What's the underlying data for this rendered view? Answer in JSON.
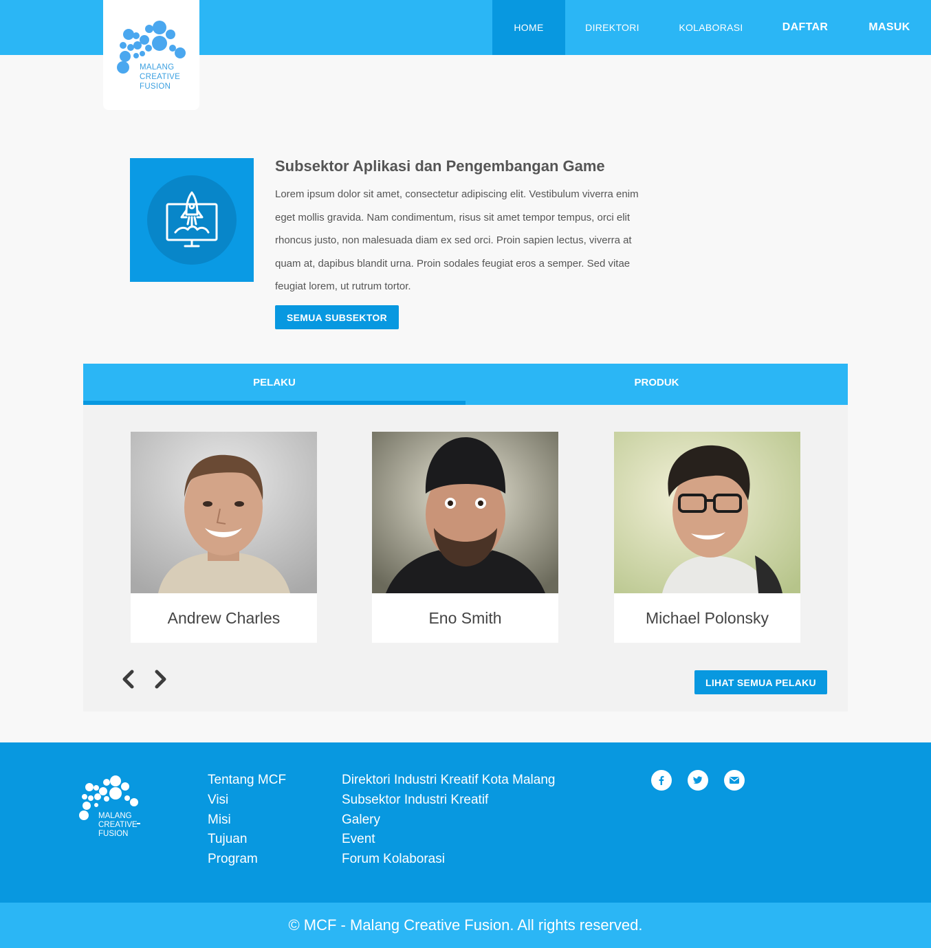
{
  "brand": {
    "name_lines": [
      "MALANG",
      "CREATIVE",
      "FUSION"
    ],
    "primary_color": "#2bb6f5",
    "accent_color": "#0898e0",
    "logo_color": "#4aa7ef"
  },
  "nav": {
    "items": [
      {
        "label": "HOME",
        "active": true
      },
      {
        "label": "DIREKTORI",
        "active": false
      },
      {
        "label": "KOLABORASI",
        "active": false
      },
      {
        "label": "DAFTAR",
        "active": false
      },
      {
        "label": "MASUK",
        "active": false
      }
    ]
  },
  "feature": {
    "icon": "rocket-monitor-icon",
    "title": "Subsektor Aplikasi dan Pengembangan Game",
    "description": "Lorem ipsum dolor sit amet, consectetur adipiscing elit. Vestibulum viverra enim eget mollis gravida. Nam condimentum, risus sit amet tempor tempus, orci elit rhoncus justo, non malesuada diam ex sed orci. Proin sapien lectus, viverra at quam at, dapibus blandit urna. Proin sodales feugiat eros a semper. Sed vitae feugiat lorem, ut rutrum tortor.",
    "button_label": "SEMUA SUBSEKTOR"
  },
  "tabs": [
    {
      "label": "PELAKU",
      "active": true
    },
    {
      "label": "PRODUK",
      "active": false
    }
  ],
  "pelaku": {
    "people": [
      {
        "name": "Andrew Charles"
      },
      {
        "name": "Eno Smith"
      },
      {
        "name": "Michael Polonsky"
      }
    ],
    "prev_icon": "chevron-left-icon",
    "next_icon": "chevron-right-icon",
    "button_label": "LIHAT SEMUA PELAKU"
  },
  "footer": {
    "links_col1": [
      "Tentang MCF",
      "Visi",
      "Misi",
      "Tujuan",
      "Program"
    ],
    "links_col2": [
      "Direktori Industri Kreatif Kota Malang",
      "Subsektor Industri Kreatif",
      "Galery",
      "Event",
      "Forum Kolaborasi"
    ],
    "social": [
      "facebook-icon",
      "twitter-icon",
      "email-icon"
    ],
    "copyright": "© MCF - Malang Creative Fusion. All rights reserved."
  }
}
